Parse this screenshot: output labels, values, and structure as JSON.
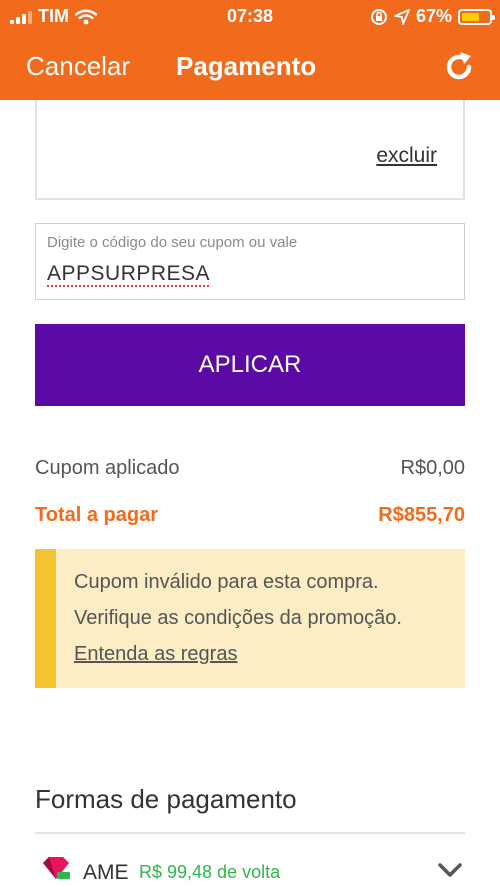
{
  "status_bar": {
    "carrier": "TIM",
    "time": "07:38",
    "battery": "67%",
    "battery_level": 0.67
  },
  "nav": {
    "cancel_label": "Cancelar",
    "title": "Pagamento",
    "refresh_icon": "refresh-icon"
  },
  "coupon_card": {
    "remove_label": "excluir"
  },
  "coupon_input": {
    "label": "Digite o código do seu cupom ou vale",
    "value": "APPSURPRESA"
  },
  "apply_button": {
    "label": "APLICAR"
  },
  "summary": {
    "coupon_label": "Cupom aplicado",
    "coupon_value": "R$0,00",
    "total_label": "Total a pagar",
    "total_value": "R$855,70"
  },
  "alert": {
    "line1": "Cupom inválido para esta compra.",
    "line2": "Verifique as condições da promoção.",
    "link_label": "Entenda as regras"
  },
  "payment_methods": {
    "title": "Formas de pagamento",
    "items": [
      {
        "name": "AME",
        "cashback": "R$ 99,48 de volta",
        "icon": "ame-logo-icon"
      }
    ]
  },
  "colors": {
    "brand_orange": "#f26a1b",
    "button_purple": "#5b0aa6",
    "alert_bg": "#fdedc5",
    "alert_bar": "#f5c531",
    "cashback_green": "#2eb84b"
  }
}
